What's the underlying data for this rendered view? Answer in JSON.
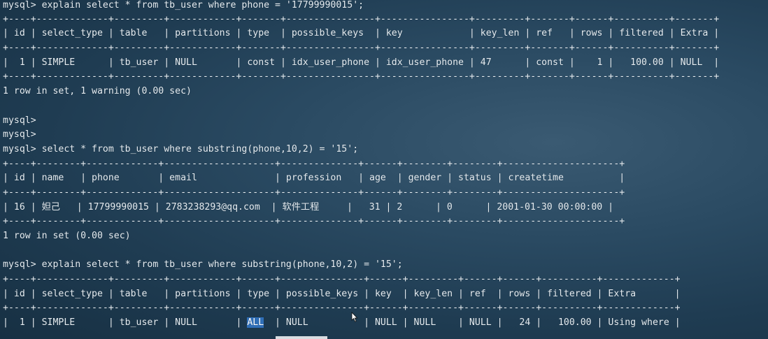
{
  "terminal": {
    "lines": [
      "mysql> explain select * from tb_user where phone = '17799990015';",
      "+----+-------------+---------+------------+-------+----------------+----------------+---------+-------+------+----------+-------+",
      "| id | select_type | table   | partitions | type  | possible_keys  | key            | key_len | ref   | rows | filtered | Extra |",
      "+----+-------------+---------+------------+-------+----------------+----------------+---------+-------+------+----------+-------+",
      "|  1 | SIMPLE      | tb_user | NULL       | const | idx_user_phone | idx_user_phone | 47      | const |    1 |   100.00 | NULL  |",
      "+----+-------------+---------+------------+-------+----------------+----------------+---------+-------+------+----------+-------+",
      "1 row in set, 1 warning (0.00 sec)",
      "",
      "mysql>",
      "mysql>",
      "mysql> select * from tb_user where substring(phone,10,2) = '15';",
      "+----+--------+-------------+--------------------+--------------+------+--------+--------+---------------------+",
      "| id | name   | phone       | email              | profession   | age  | gender | status | createtime          |",
      "+----+--------+-------------+--------------------+--------------+------+--------+--------+---------------------+",
      "| 16 | 妲己   | 17799990015 | 2783238293@qq.com  | 软件工程     |   31 | 2      | 0      | 2001-01-30 00:00:00 |",
      "+----+--------+-------------+--------------------+--------------+------+--------+--------+---------------------+",
      "1 row in set (0.00 sec)",
      "",
      "mysql> explain select * from tb_user where substring(phone,10,2) = '15';",
      "+----+-------------+---------+------------+------+---------------+------+---------+------+------+----------+-------------+",
      "| id | select_type | table   | partitions | type | possible_keys | key  | key_len | ref  | rows | filtered | Extra       |",
      "+----+-------------+---------+------------+------+---------------+------+---------+------+------+----------+-------------+"
    ],
    "last_row": {
      "before": "|  1 | SIMPLE      | tb_user | NULL       | ",
      "highlight": "ALL",
      "after": "  | NULL          | NULL | NULL    | NULL |   24 |   100.00 | Using where |"
    }
  }
}
